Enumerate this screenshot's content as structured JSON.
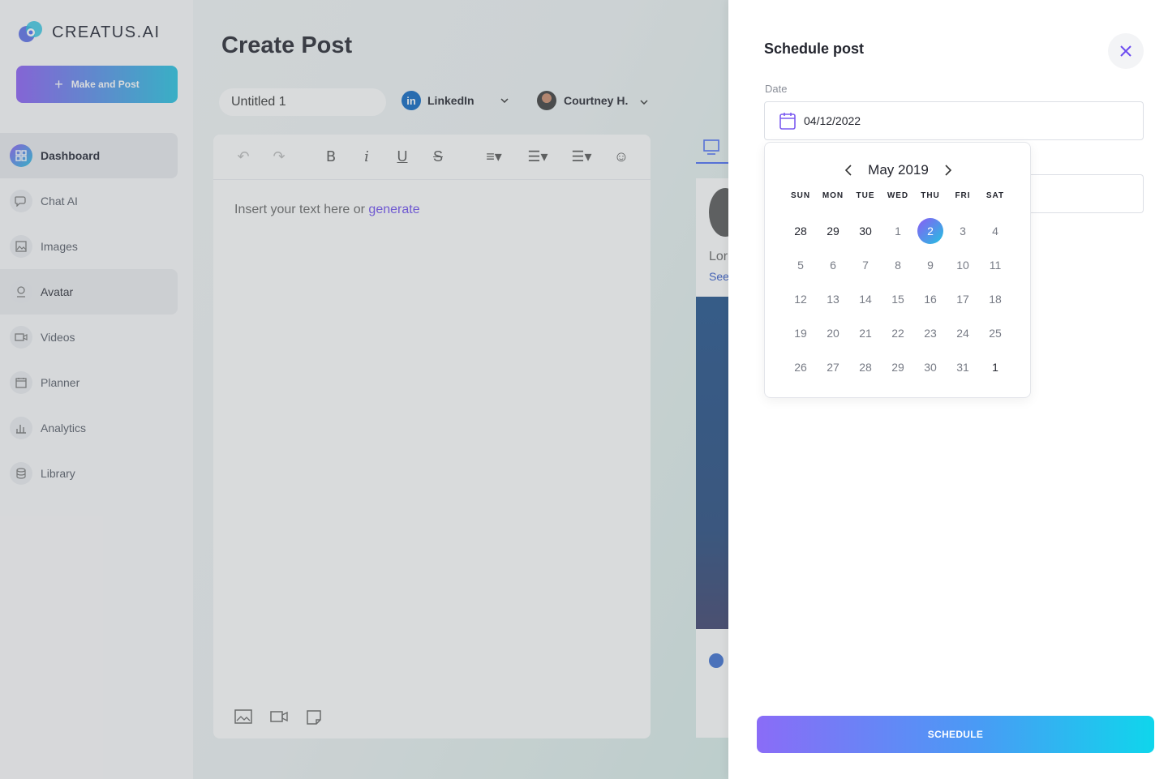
{
  "app": {
    "brand": "CREATUS.AI",
    "make_post_label": "Make and Post",
    "nav": [
      {
        "label": "Dashboard",
        "icon": "dashboard-icon"
      },
      {
        "label": "Chat AI",
        "icon": "chat-icon"
      },
      {
        "label": "Images",
        "icon": "image-icon"
      },
      {
        "label": "Avatar",
        "icon": "avatar-icon"
      },
      {
        "label": "Videos",
        "icon": "video-icon"
      },
      {
        "label": "Planner",
        "icon": "calendar-icon"
      },
      {
        "label": "Analytics",
        "icon": "bar-chart-icon"
      },
      {
        "label": "Library",
        "icon": "database-icon"
      }
    ],
    "page_title": "Create Post",
    "post_title_value": "Untitled 1",
    "platform": "LinkedIn",
    "platform_badge": "in",
    "account": "Courtney H.",
    "editor_placeholder": "Insert your text here or",
    "editor_generate_link": "generate",
    "preview_text": "Lor",
    "preview_link": "See"
  },
  "drawer": {
    "title": "Schedule post",
    "date_label": "Date",
    "date_value": "04/12/2022",
    "schedule_label": "SCHEDULE",
    "calendar": {
      "month_label": "May 2019",
      "weekdays": [
        "SUN",
        "MON",
        "TUE",
        "WED",
        "THU",
        "FRI",
        "SAT"
      ],
      "weeks": [
        [
          "28",
          "29",
          "30",
          "1",
          "2",
          "3",
          "4"
        ],
        [
          "5",
          "6",
          "7",
          "8",
          "9",
          "10",
          "11"
        ],
        [
          "12",
          "13",
          "14",
          "15",
          "16",
          "17",
          "18"
        ],
        [
          "19",
          "20",
          "21",
          "22",
          "23",
          "24",
          "25"
        ],
        [
          "26",
          "27",
          "28",
          "29",
          "30",
          "31",
          "1"
        ]
      ],
      "selected_day": "2"
    }
  },
  "colors": {
    "accent_purple": "#8a5cf5",
    "accent_cyan": "#22c2e0",
    "linkedin": "#0a66c2",
    "close_icon": "#6c4cf0"
  }
}
